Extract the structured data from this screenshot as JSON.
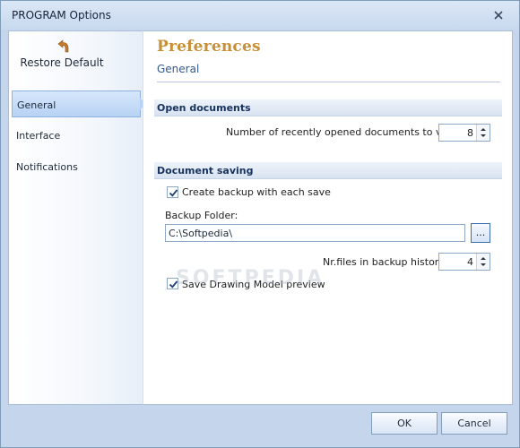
{
  "window": {
    "title": "PROGRAM Options"
  },
  "sidebar": {
    "restore_label": "Restore Default",
    "items": [
      {
        "label": "General",
        "selected": true
      },
      {
        "label": "Interface",
        "selected": false
      },
      {
        "label": "Notifications",
        "selected": false
      }
    ]
  },
  "content": {
    "title": "Preferences",
    "subtitle": "General",
    "open_documents": {
      "heading": "Open documents",
      "recent_label": "Number of recently opened documents to view:",
      "recent_value": "8"
    },
    "document_saving": {
      "heading": "Document saving",
      "create_backup_label": "Create backup with each save",
      "create_backup_checked": true,
      "backup_folder_label": "Backup Folder:",
      "backup_folder_value": "C:\\Softpedia\\",
      "browse_label": "...",
      "history_label": "Nr.files in backup history:",
      "history_value": "4",
      "save_preview_label": "Save Drawing Model preview",
      "save_preview_checked": true
    }
  },
  "watermark": "SOFTPEDIA",
  "footer": {
    "ok_label": "OK",
    "cancel_label": "Cancel"
  },
  "colors": {
    "accent_title": "#c88f36",
    "frame": "#c4d5ec",
    "selected_nav": "#b7d2f4"
  }
}
